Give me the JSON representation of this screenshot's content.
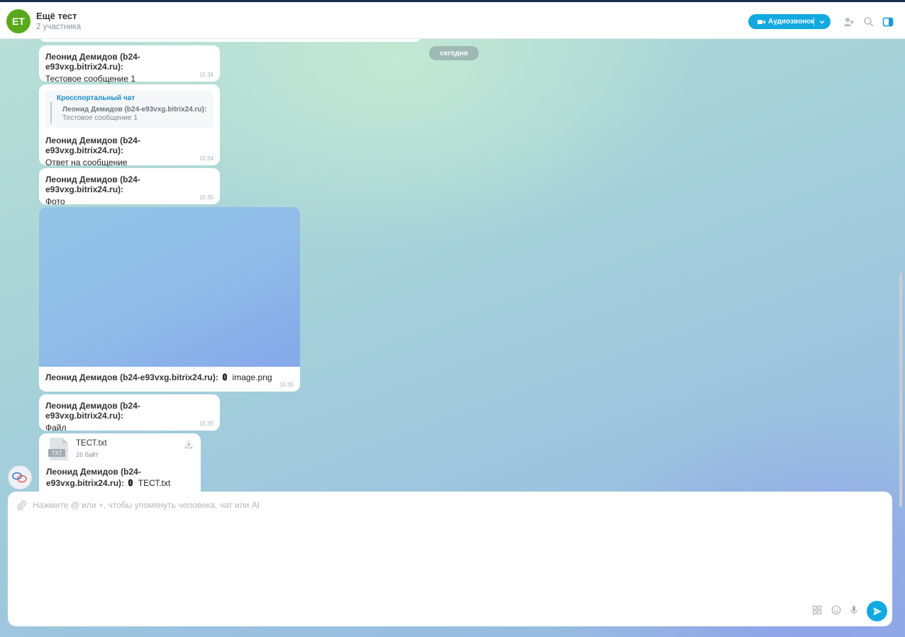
{
  "header": {
    "avatar_initials": "ET",
    "title": "Ещё тест",
    "subtitle": "2 участника",
    "call_button_label": "Аудиозвонок",
    "icons": [
      "video-camera-icon",
      "chevron-down-icon",
      "add-user-icon",
      "search-icon",
      "panel-toggle-icon"
    ]
  },
  "date_separator": "сегодня",
  "messages": [
    {
      "author": "Леонид Демидов (b24-e93vxg.bitrix24.ru):",
      "text": "Тестовое сообщение 1",
      "time": "15:34"
    },
    {
      "quote": {
        "title": "Кросспортальный чат",
        "author": "Леонид Демидов (b24-e93vxg.bitrix24.ru):",
        "text": "Тестовое сообщение 1"
      },
      "author": "Леонид Демидов (b24-e93vxg.bitrix24.ru):",
      "text": "Ответ на сообщение",
      "time": "15:34"
    },
    {
      "author": "Леонид Демидов (b24-e93vxg.bitrix24.ru):",
      "text": "Фото",
      "time": "15:35"
    },
    {
      "author": "Леонид Демидов (b24-e93vxg.bitrix24.ru):",
      "attachment": "image.png",
      "time": "15:35"
    },
    {
      "author": "Леонид Демидов (b24-e93vxg.bitrix24.ru):",
      "text": "Файл",
      "time": "15:35"
    },
    {
      "file_name": "ТЕСТ.txt",
      "file_size": "26 байт",
      "file_icon_label": "TXT",
      "author": "Леонид Демидов (b24-e93vxg.bitrix24.ru):",
      "attachment": "ТЕСТ.txt"
    }
  ],
  "composer": {
    "placeholder": "Нажмите @ или +, чтобы упомянуть человека, чат или AI",
    "value": "",
    "icons": [
      "paperclip-icon",
      "apps-grid-icon",
      "emoji-icon",
      "microphone-icon",
      "send-icon"
    ]
  },
  "colors": {
    "accent": "#11a9e0",
    "avatar": "#58a91b",
    "quote_title": "#1a8bc9"
  }
}
